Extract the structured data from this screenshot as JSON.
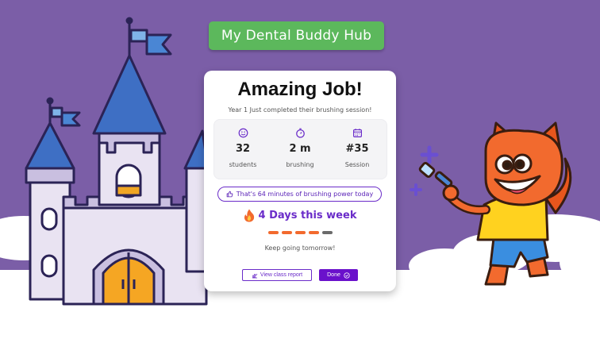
{
  "header": {
    "hub_label": "My Dental Buddy Hub"
  },
  "card": {
    "title": "Amazing Job!",
    "subtitle": "Year 1 Just completed their brushing session!",
    "stats": [
      {
        "icon": "smiley-icon",
        "value": "32",
        "label": "students"
      },
      {
        "icon": "stopwatch-icon",
        "value": "2 m",
        "label": "brushing"
      },
      {
        "icon": "calendar-icon",
        "value": "#35",
        "label": "Session"
      }
    ],
    "power_text": "That's 64 minutes of brushing power today",
    "streak_text": "4 Days this week",
    "streak": {
      "filled": 4,
      "total": 5
    },
    "keep_going": "Keep going tomorrow!",
    "view_report_label": "View class report",
    "done_label": "Done"
  },
  "colors": {
    "background": "#7b5ea7",
    "hub_button": "#5cb85c",
    "accent": "#6a2cc9",
    "streak_filled": "#f26a2e",
    "streak_empty": "#6b6b6b"
  }
}
